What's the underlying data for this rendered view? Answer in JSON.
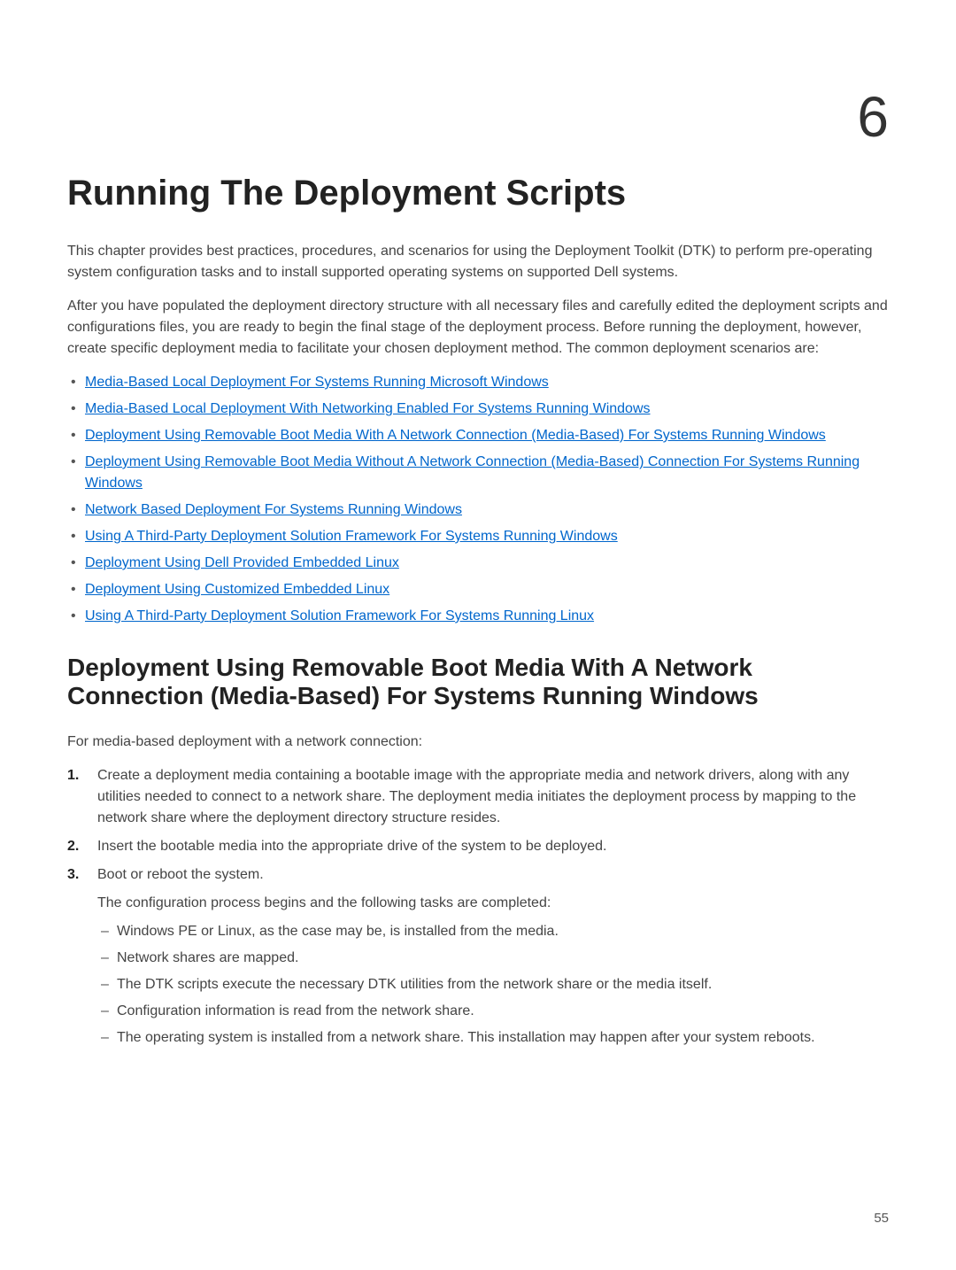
{
  "chapter_number": "6",
  "chapter_title": "Running The Deployment Scripts",
  "intro_p1": "This chapter provides best practices, procedures, and scenarios for using the Deployment Toolkit (DTK) to perform pre-operating system configuration tasks and to install supported operating systems on supported Dell systems.",
  "intro_p2": "After you have populated the deployment directory structure with all necessary files and carefully edited the deployment scripts and configurations files, you are ready to begin the final stage of the deployment process. Before running the deployment, however, create specific deployment media to facilitate your chosen deployment method. The common deployment scenarios are:",
  "links": [
    "Media-Based Local Deployment For Systems Running Microsoft Windows",
    "Media-Based Local Deployment With Networking Enabled For Systems Running Windows",
    "Deployment Using Removable Boot Media With A Network Connection (Media-Based) For Systems Running Windows",
    "Deployment Using Removable Boot Media Without A Network Connection (Media-Based) Connection For Systems Running Windows",
    "Network Based Deployment For Systems Running Windows",
    "Using A Third-Party Deployment Solution Framework For Systems Running Windows",
    "Deployment Using Dell Provided Embedded Linux",
    "Deployment Using Customized Embedded Linux",
    "Using A Third-Party Deployment Solution Framework For Systems Running Linux"
  ],
  "section_heading": "Deployment Using Removable Boot Media With A Network Connection (Media-Based) For Systems Running Windows",
  "section_intro": "For media-based deployment with a network connection:",
  "steps": [
    {
      "num": "1.",
      "text": "Create a deployment media containing a bootable image with the appropriate media and network drivers, along with any utilities needed to connect to a network share. The deployment media initiates the deployment process by mapping to the network share where the deployment directory structure resides."
    },
    {
      "num": "2.",
      "text": "Insert the bootable media into the appropriate drive of the system to be deployed."
    },
    {
      "num": "3.",
      "text": "Boot or reboot the system.",
      "sub_text": "The configuration process begins and the following tasks are completed:",
      "sub_items": [
        "Windows PE or Linux, as the case may be, is installed from the media.",
        "Network shares are mapped.",
        "The DTK scripts execute the necessary DTK utilities from the network share or the media itself.",
        "Configuration information is read from the network share.",
        "The operating system is installed from a network share. This installation may happen after your system reboots."
      ]
    }
  ],
  "page_number": "55"
}
